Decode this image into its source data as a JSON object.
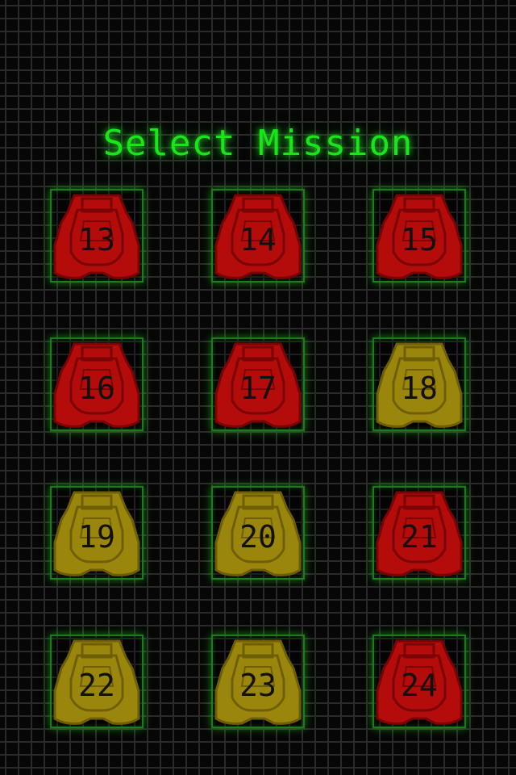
{
  "screen": {
    "title": "Select Mission"
  },
  "colors": {
    "grid_line": "#2a2a2a",
    "title": "#19e619",
    "tile_border": "#1f7a1f",
    "status_red_fill": "#b40b0b",
    "status_red_stroke": "#7a0404",
    "status_yellow_fill": "#9b860d",
    "status_yellow_stroke": "#6e5f06"
  },
  "missions": [
    {
      "number": "13",
      "status": "red",
      "icon": "mission-pod-icon"
    },
    {
      "number": "14",
      "status": "red",
      "icon": "mission-pod-icon"
    },
    {
      "number": "15",
      "status": "red",
      "icon": "mission-pod-icon"
    },
    {
      "number": "16",
      "status": "red",
      "icon": "mission-pod-icon"
    },
    {
      "number": "17",
      "status": "red",
      "icon": "mission-pod-icon"
    },
    {
      "number": "18",
      "status": "yellow",
      "icon": "mission-pod-icon"
    },
    {
      "number": "19",
      "status": "yellow",
      "icon": "mission-pod-icon"
    },
    {
      "number": "20",
      "status": "yellow",
      "icon": "mission-pod-icon"
    },
    {
      "number": "21",
      "status": "red",
      "icon": "mission-pod-icon"
    },
    {
      "number": "22",
      "status": "yellow",
      "icon": "mission-pod-icon"
    },
    {
      "number": "23",
      "status": "yellow",
      "icon": "mission-pod-icon"
    },
    {
      "number": "24",
      "status": "red",
      "icon": "mission-pod-icon"
    }
  ]
}
